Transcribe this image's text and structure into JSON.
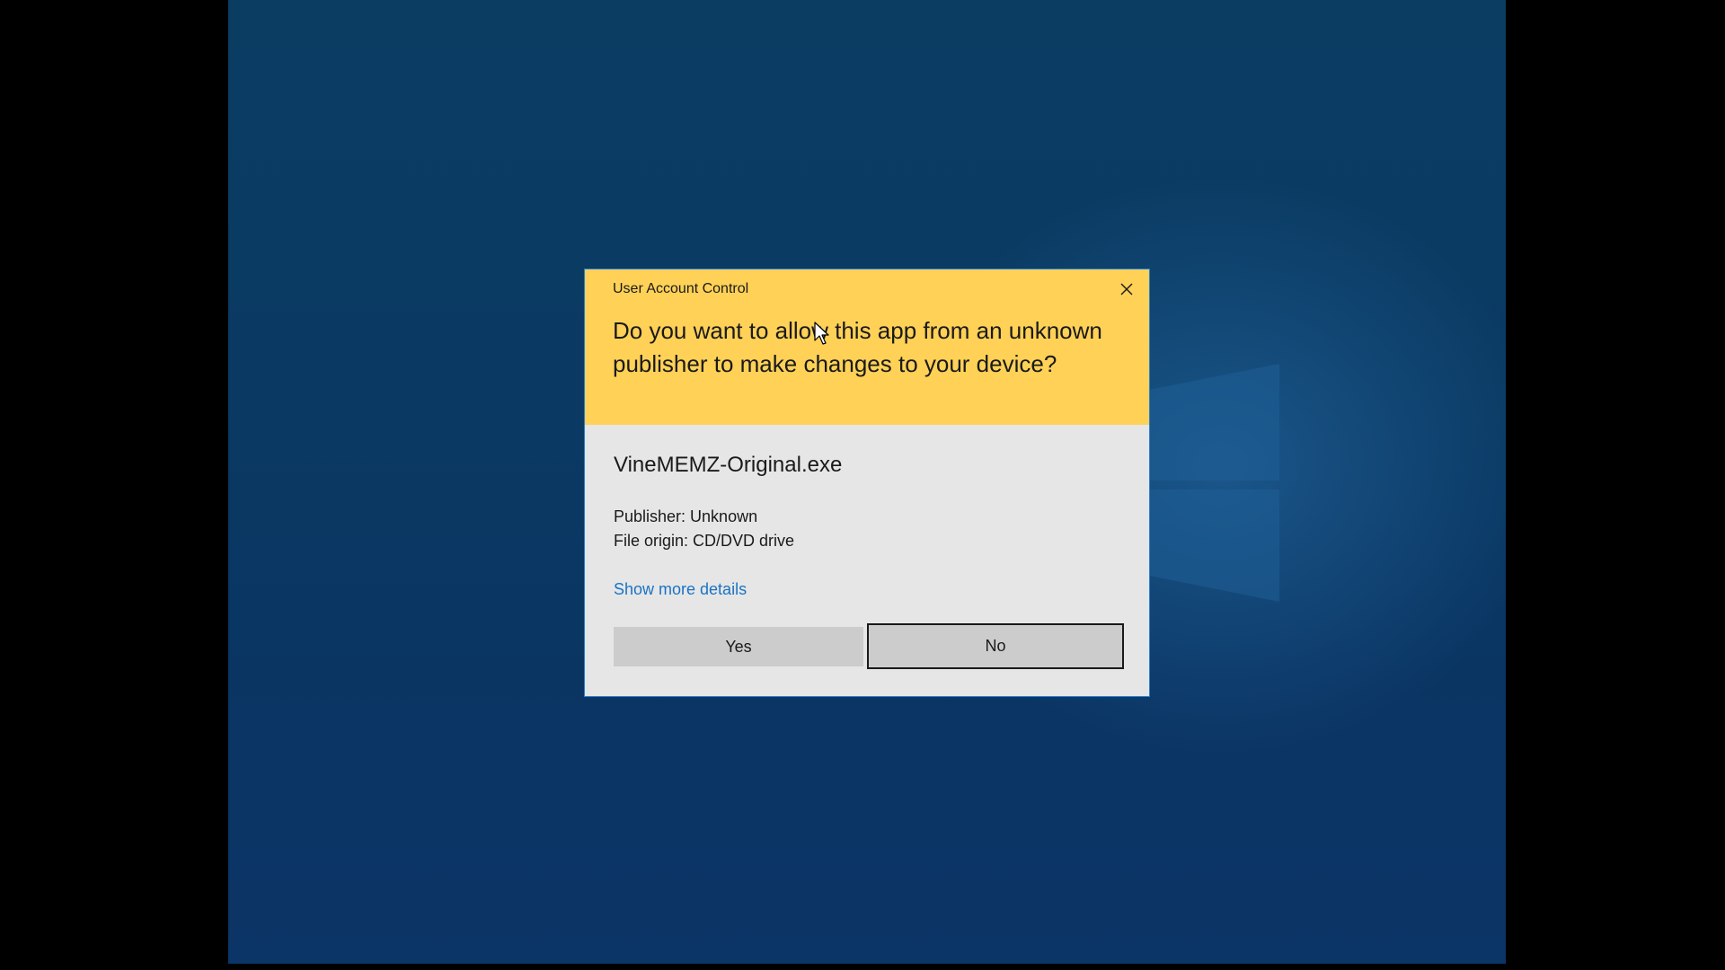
{
  "dialog": {
    "title": "User Account Control",
    "question": "Do you want to allow this app from an unknown publisher to make changes to your device?",
    "app_name": "VineMEMZ-Original.exe",
    "publisher": "Publisher: Unknown",
    "file_origin": "File origin: CD/DVD drive",
    "details_link": "Show more details",
    "yes_label": "Yes",
    "no_label": "No",
    "close_icon": "close-icon"
  },
  "colors": {
    "header": "#ffd157",
    "body": "#e6e6e6",
    "link": "#1a73c4",
    "button": "#cccccc",
    "dialog_border": "#2a7fd4",
    "desktop": "#0a3a63"
  }
}
